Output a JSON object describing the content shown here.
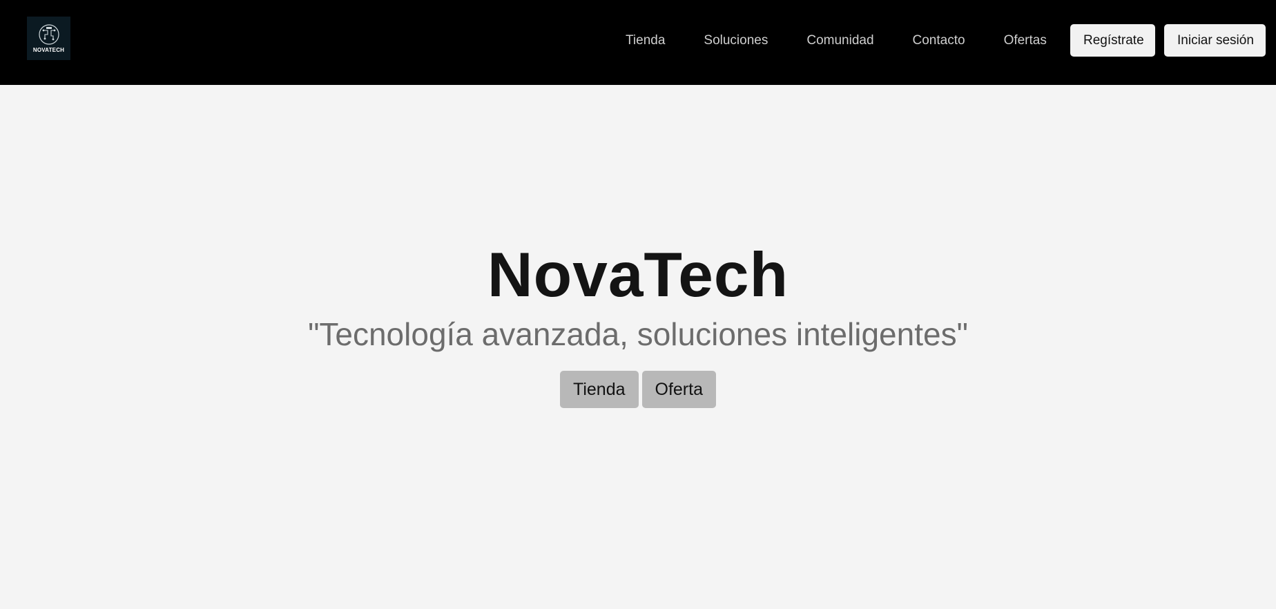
{
  "logo": {
    "name": "NOVATECH"
  },
  "nav": {
    "links": [
      {
        "label": "Tienda"
      },
      {
        "label": "Soluciones"
      },
      {
        "label": "Comunidad"
      },
      {
        "label": "Contacto"
      },
      {
        "label": "Ofertas"
      }
    ],
    "register_label": "Regístrate",
    "login_label": "Iniciar sesión"
  },
  "hero": {
    "title": "NovaTech",
    "subtitle": "\"Tecnología avanzada, soluciones inteligentes\"",
    "buttons": [
      {
        "label": "Tienda"
      },
      {
        "label": "Oferta"
      }
    ]
  },
  "colors": {
    "header_bg": "#000000",
    "page_bg": "#f4f4f4",
    "hero_button_bg": "#b8b8b8",
    "auth_button_bg": "#f2f2f2"
  }
}
